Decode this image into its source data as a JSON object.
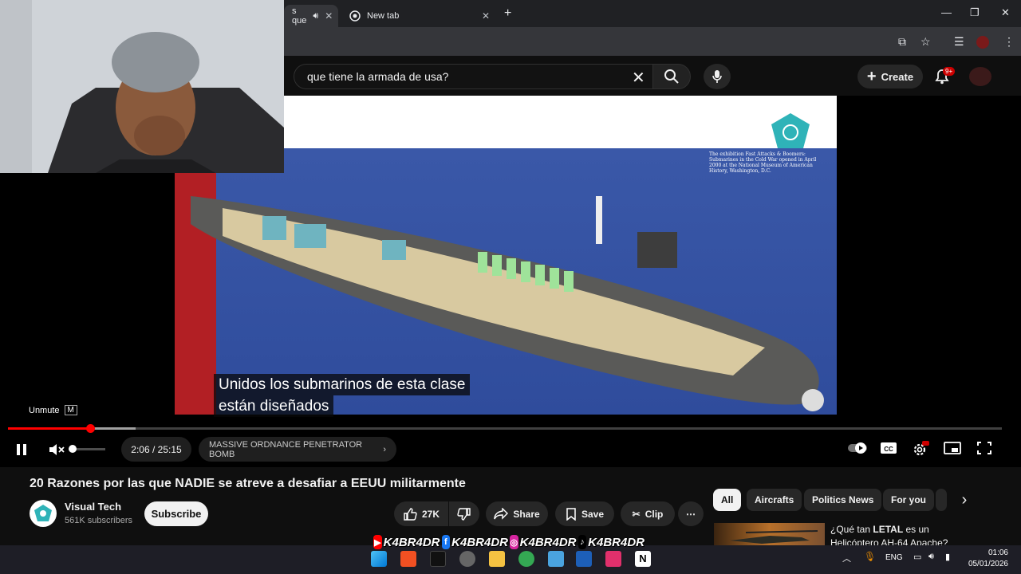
{
  "browser": {
    "active_tab_label": "s que",
    "new_tab_label": "New tab"
  },
  "header": {
    "search_value": "que tiene la armada de usa?",
    "create_label": "Create",
    "notification_badge": "9+"
  },
  "player": {
    "subtitle_lines": [
      "Unidos los submarinos de esta clase",
      "están diseñados"
    ],
    "tooltip_label": "Unmute",
    "tooltip_key": "M",
    "time_current": "2:06",
    "time_total": "25:15",
    "time_display": "2:06 / 25:15",
    "chapter_label": "MASSIVE ORDNANCE PENETRATOR BOMB",
    "progress_fraction": 0.083,
    "volume_fraction": 0.0,
    "subtitles_on": true
  },
  "video": {
    "title": "20 Razones por las que NADIE se atreve a desafiar a EEUU militarmente",
    "channel_name": "Visual Tech",
    "channel_subs": "561K subscribers",
    "subscribe_label": "Subscribe",
    "like_count": "27K",
    "share_label": "Share",
    "save_label": "Save",
    "clip_label": "Clip"
  },
  "chips": [
    "All",
    "Aircrafts",
    "Politics News",
    "For you"
  ],
  "recommendation": {
    "title_prefix": "¿Qué tan ",
    "title_bold": "LETAL",
    "title_suffix": " es un Helicóptero AH-64 Apache?"
  },
  "overlay_banner": {
    "handle": "K4BR4DR"
  },
  "taskbar": {
    "lang": "ENG",
    "time": "01:06",
    "date": "05/01/2026"
  },
  "colors": {
    "youtube_red": "#ff0000",
    "background": "#0f0f0f",
    "chip_bg": "#272727"
  }
}
